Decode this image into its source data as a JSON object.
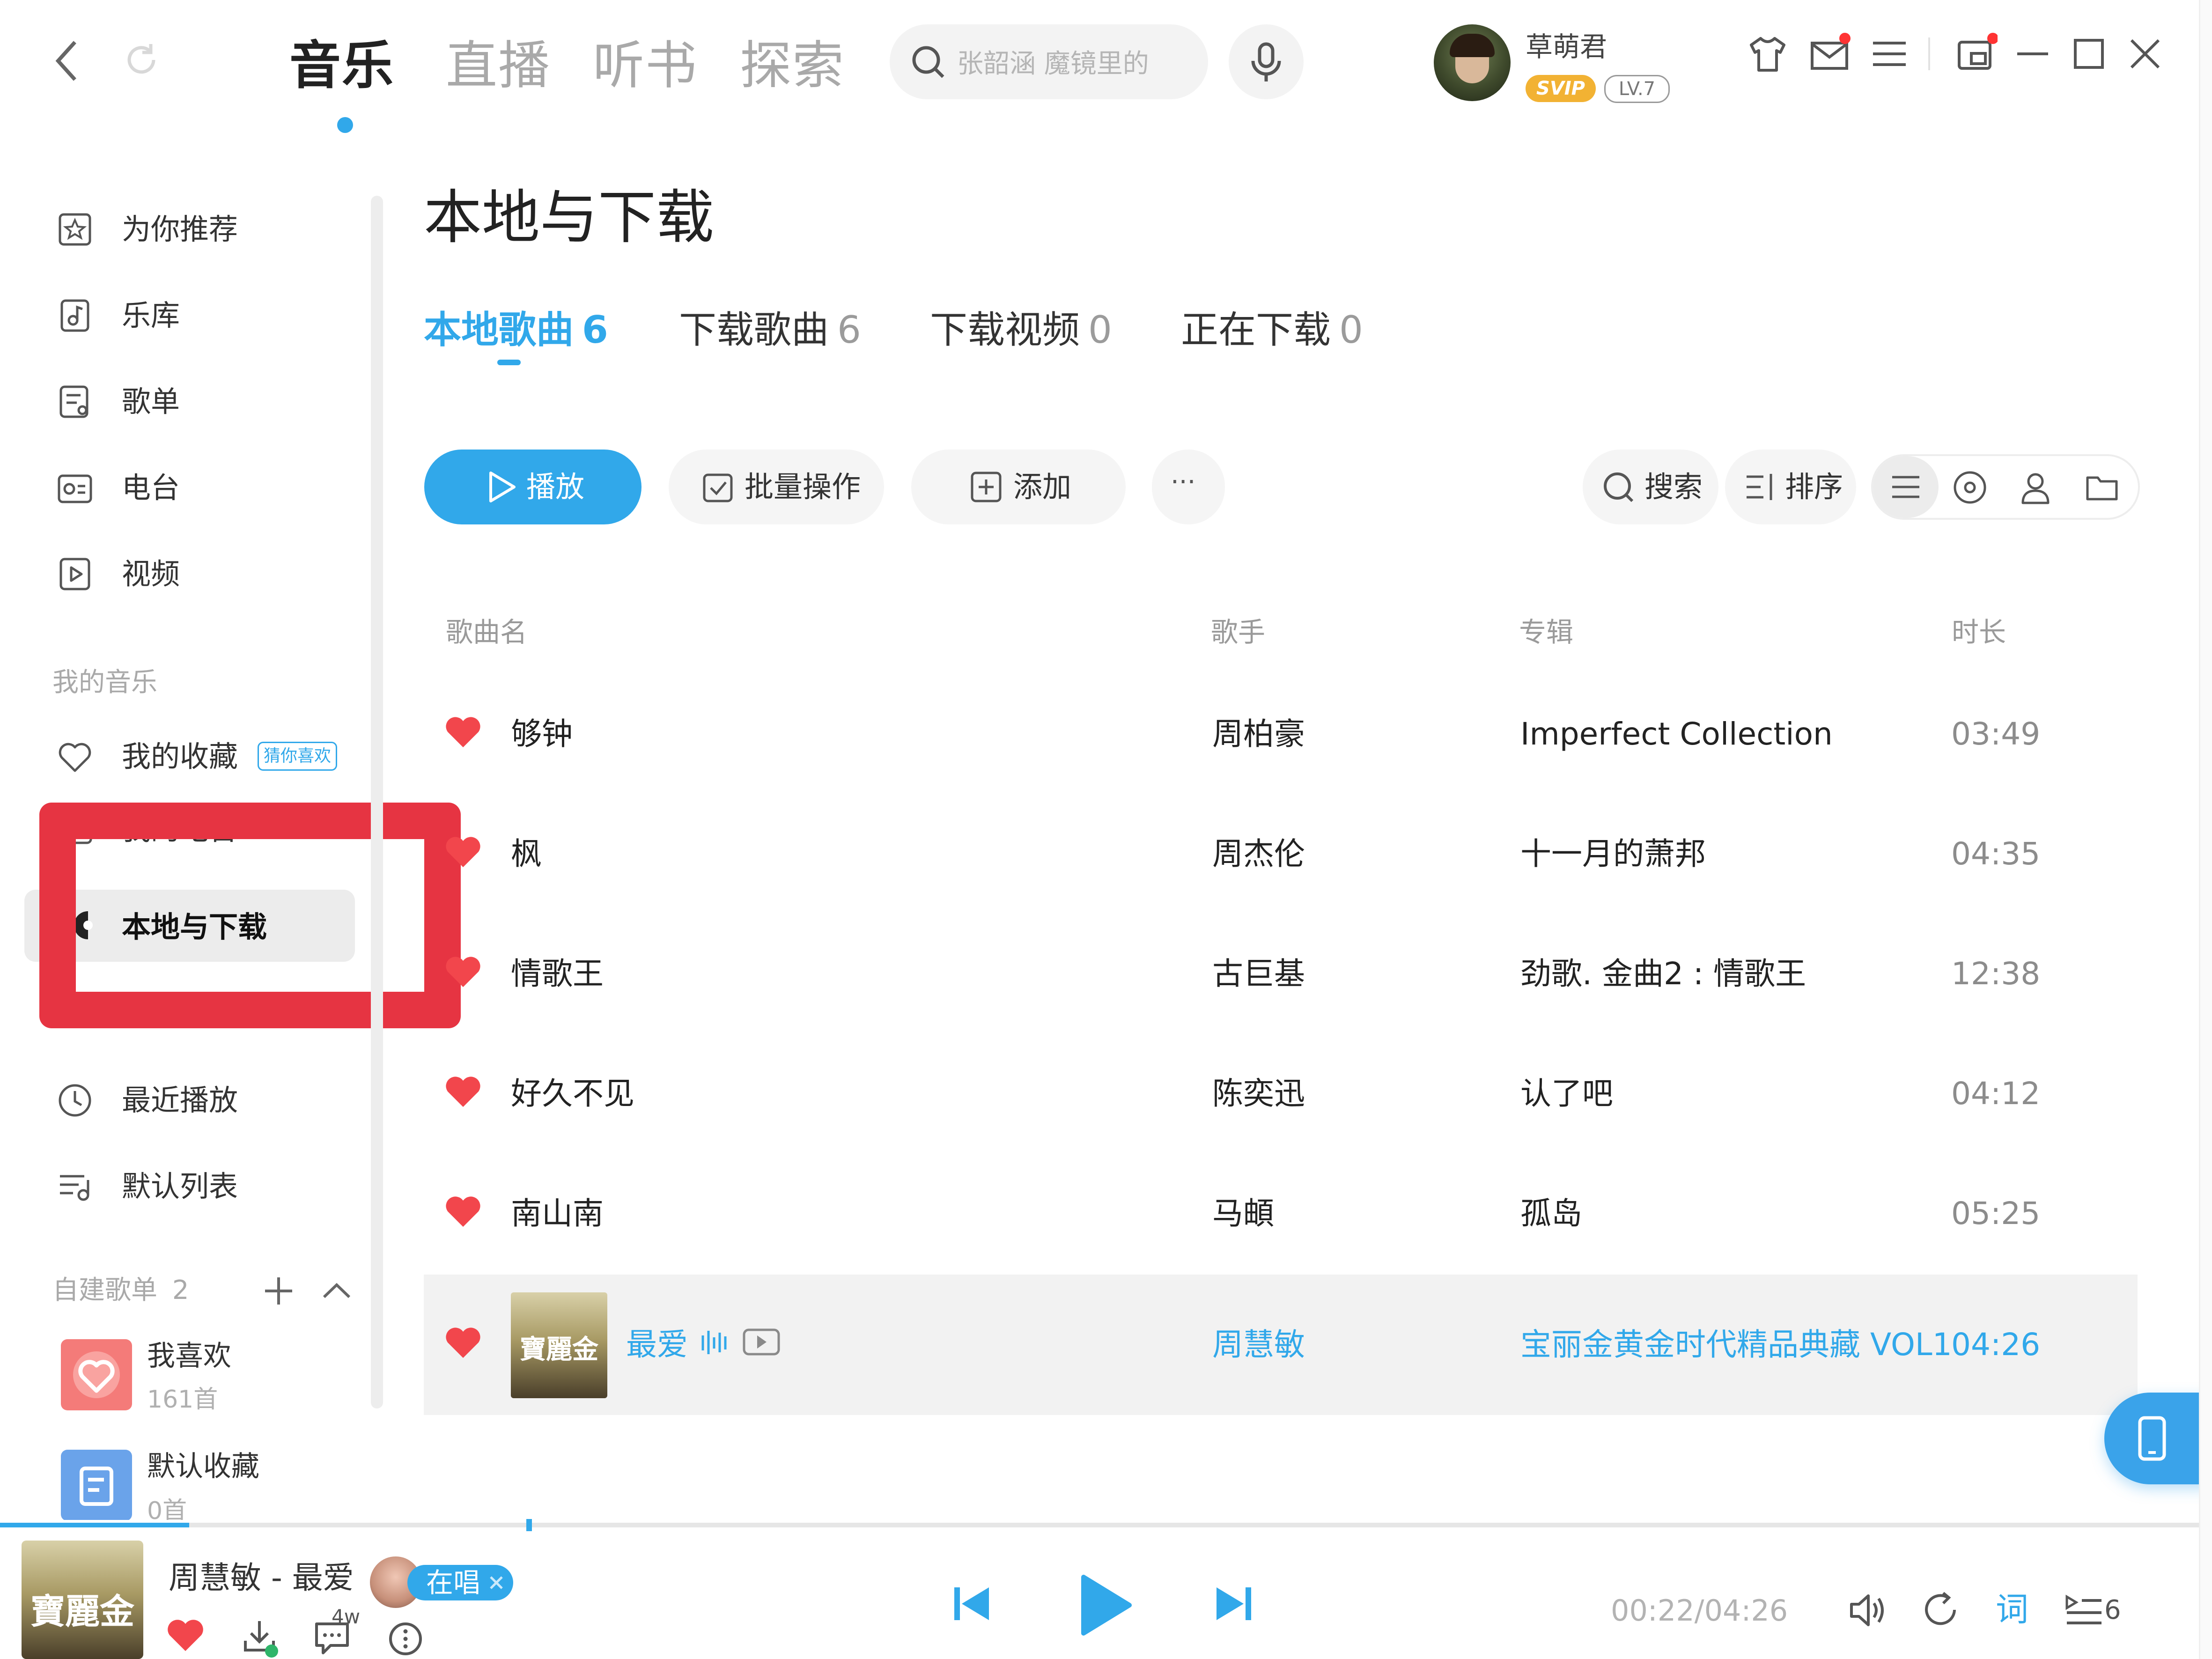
{
  "window": {
    "back": "back",
    "refresh": "refresh"
  },
  "nav": {
    "tabs": [
      {
        "label": "音乐",
        "active": true
      },
      {
        "label": "直播",
        "active": false
      },
      {
        "label": "听书",
        "active": false
      },
      {
        "label": "探索",
        "active": false
      }
    ],
    "search_placeholder": "张韶涵 魔镜里的"
  },
  "user": {
    "name": "草萌君",
    "vip_badge": "SVIP",
    "level_badge": "LV.7"
  },
  "sidebar": {
    "items": [
      {
        "label": "为你推荐",
        "icon": "star-icon"
      },
      {
        "label": "乐库",
        "icon": "music-library-icon"
      },
      {
        "label": "歌单",
        "icon": "playlist-icon"
      },
      {
        "label": "电台",
        "icon": "radio-icon"
      },
      {
        "label": "视频",
        "icon": "video-icon"
      }
    ],
    "my_music_title": "我的音乐",
    "my_items": [
      {
        "label": "我的收藏",
        "icon": "heart-icon",
        "tag": "猜你喜欢"
      },
      {
        "label": "我的电台",
        "icon": "radio-icon"
      },
      {
        "label": "本地与下载",
        "icon": "download-icon",
        "active": true
      },
      {
        "label": "最近播放",
        "icon": "clock-icon"
      },
      {
        "label": "默认列表",
        "icon": "list-icon"
      }
    ],
    "created_title": "自建歌单",
    "created_count": "2",
    "playlists": [
      {
        "name": "我喜欢",
        "count": "161首"
      },
      {
        "name": "默认收藏",
        "count": "0首"
      }
    ]
  },
  "main": {
    "title": "本地与下载",
    "tabs": [
      {
        "label": "本地歌曲",
        "count": "6",
        "active": true
      },
      {
        "label": "下载歌曲",
        "count": "6",
        "active": false
      },
      {
        "label": "下载视频",
        "count": "0",
        "active": false
      },
      {
        "label": "正在下载",
        "count": "0",
        "active": false
      }
    ],
    "toolbar": {
      "play": "播放",
      "batch": "批量操作",
      "add": "添加",
      "more": "···",
      "search": "搜索",
      "sort": "排序"
    },
    "columns": {
      "name": "歌曲名",
      "artist": "歌手",
      "album": "专辑",
      "duration": "时长"
    },
    "songs": [
      {
        "name": "够钟",
        "artist": "周柏豪",
        "album": "Imperfect Collection",
        "duration": "03:49"
      },
      {
        "name": "枫",
        "artist": "周杰伦",
        "album": "十一月的萧邦",
        "duration": "04:35"
      },
      {
        "name": "情歌王",
        "artist": "古巨基",
        "album": "劲歌. 金曲2 : 情歌王",
        "duration": "12:38"
      },
      {
        "name": "好久不见",
        "artist": "陈奕迅",
        "album": "认了吧",
        "duration": "04:12"
      },
      {
        "name": "南山南",
        "artist": "马頔",
        "album": "孤岛",
        "duration": "05:25"
      },
      {
        "name": "最爱",
        "artist": "周慧敏",
        "album": "宝丽金黄金时代精品典藏 VOL1",
        "duration": "04:26",
        "playing": true
      }
    ]
  },
  "player": {
    "now_playing": "周慧敏 - 最爱",
    "sing_badge": "在唱",
    "comment_count": "4w",
    "time": "00:22/04:26",
    "lyrics_btn": "词",
    "queue_count": "6",
    "album_art_text": "寶麗金",
    "progress": 0.086
  },
  "colors": {
    "accent": "#31a8ea",
    "heart": "#f2464c",
    "highlight_box": "#e63442"
  }
}
